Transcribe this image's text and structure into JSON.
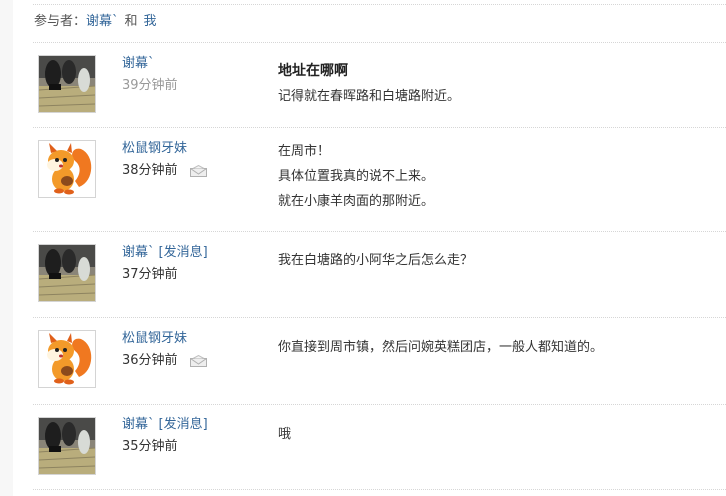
{
  "participants": {
    "label": "参与者：",
    "user1": "谢幕`",
    "joiner": "和",
    "user2": "我"
  },
  "messages": [
    {
      "user": "谢幕`",
      "time": "39分钟前",
      "avatar": "photo-avatar",
      "subject": "地址在哪啊",
      "lines": [
        "记得就在春晖路和白塘路附近。"
      ]
    },
    {
      "user": "松鼠钢牙妹",
      "time": "38分钟前",
      "avatar": "squirrel-avatar",
      "icon": "mail-icon",
      "lines": [
        "在周市！",
        "具体位置我真的说不上来。",
        "就在小康羊肉面的那附近。"
      ]
    },
    {
      "user": "谢幕`",
      "send_label": "[发消息]",
      "time": "37分钟前",
      "avatar": "photo-avatar",
      "lines": [
        "我在白塘路的小阿华之后怎么走？"
      ]
    },
    {
      "user": "松鼠钢牙妹",
      "time": "36分钟前",
      "avatar": "squirrel-avatar",
      "icon": "mail-icon",
      "lines": [
        "你直接到周市镇，然后问婉英糕团店，一般人都知道的。"
      ]
    },
    {
      "user": "谢幕`",
      "send_label": "[发消息]",
      "time": "35分钟前",
      "avatar": "photo-avatar",
      "lines": [
        "哦"
      ]
    }
  ],
  "colors": {
    "link": "#336699",
    "muted_time": "#999999",
    "divider": "#d6d6d6"
  }
}
